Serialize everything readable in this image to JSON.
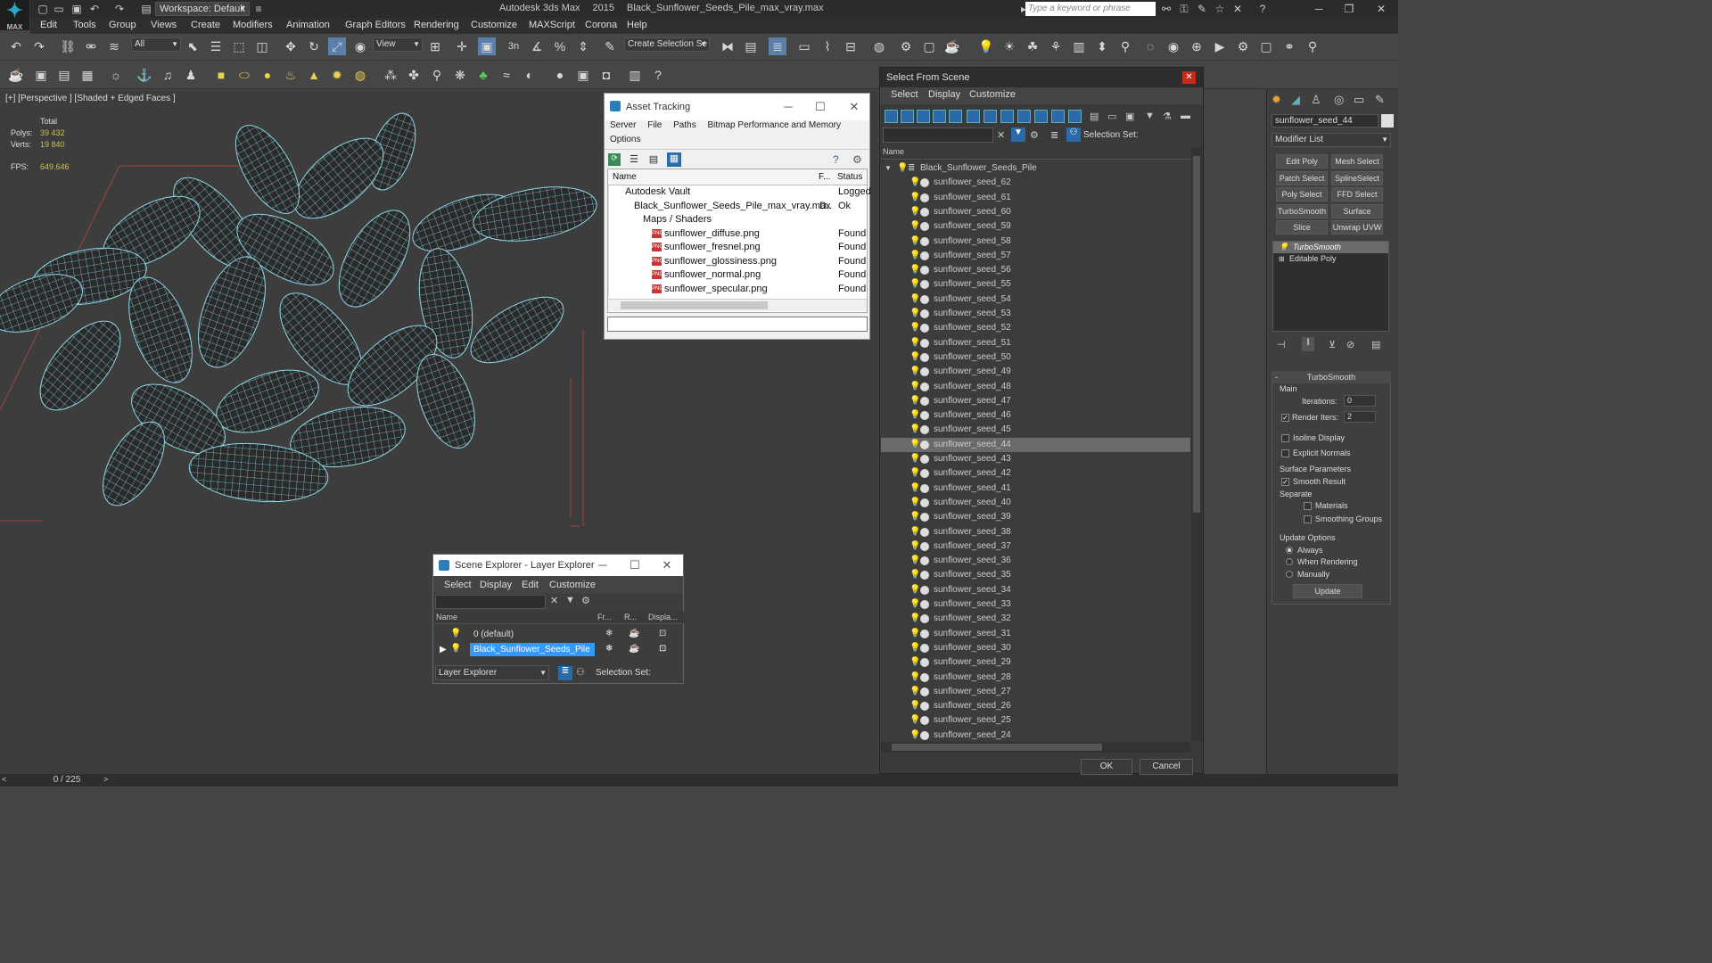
{
  "app": {
    "name": "Autodesk 3ds Max",
    "version": "2015",
    "file": "Black_Sunflower_Seeds_Pile_max_vray.max",
    "logo_text": "MAX",
    "workspace": "Workspace: Default",
    "search_placeholder": "Type a keyword or phrase"
  },
  "menus": [
    "Edit",
    "Tools",
    "Group",
    "Views",
    "Create",
    "Modifiers",
    "Animation",
    "Graph Editors",
    "Rendering",
    "Customize",
    "MAXScript",
    "Corona",
    "Help"
  ],
  "toolbar": {
    "selection_filter": "All",
    "ref_coord": "View",
    "create_selection_set": "Create Selection Se",
    "snap_label": "3n"
  },
  "viewport": {
    "label": "[+] [Perspective ] [Shaded + Edged Faces ]",
    "stats": {
      "total_label": "Total",
      "polys_label": "Polys:",
      "polys": "39 432",
      "verts_label": "Verts:",
      "verts": "19 840",
      "fps_label": "FPS:",
      "fps": "649.646"
    }
  },
  "timeline": {
    "frame": "0 / 225"
  },
  "asset_tracking": {
    "title": "Asset Tracking",
    "menus": [
      "Server",
      "File",
      "Paths",
      "Bitmap Performance and Memory",
      "Options"
    ],
    "columns": [
      "Name",
      "F...",
      "Status"
    ],
    "rows": [
      {
        "name": "Autodesk Vault",
        "f": "",
        "status": "Logged",
        "indent": 1
      },
      {
        "name": "Black_Sunflower_Seeds_Pile_max_vray.max",
        "f": "D..",
        "status": "Ok",
        "indent": 2
      },
      {
        "name": "Maps / Shaders",
        "f": "",
        "status": "",
        "indent": 3
      },
      {
        "name": "sunflower_diffuse.png",
        "f": "",
        "status": "Found",
        "indent": 4
      },
      {
        "name": "sunflower_fresnel.png",
        "f": "",
        "status": "Found",
        "indent": 4
      },
      {
        "name": "sunflower_glossiness.png",
        "f": "",
        "status": "Found",
        "indent": 4
      },
      {
        "name": "sunflower_normal.png",
        "f": "",
        "status": "Found",
        "indent": 4
      },
      {
        "name": "sunflower_specular.png",
        "f": "",
        "status": "Found",
        "indent": 4
      }
    ],
    "png_badge": "PNG"
  },
  "scene_explorer": {
    "title": "Scene Explorer - Layer Explorer",
    "menus": [
      "Select",
      "Display",
      "Edit",
      "Customize"
    ],
    "columns": [
      "Name",
      "Fr...",
      "R...",
      "Displa..."
    ],
    "rows": [
      {
        "name": "0 (default)",
        "selected": false
      },
      {
        "name": "Black_Sunflower_Seeds_Pile",
        "selected": true
      }
    ],
    "footer_dropdown": "Layer Explorer",
    "selection_set": "Selection Set:"
  },
  "select_from_scene": {
    "title": "Select From Scene",
    "menus": [
      "Select",
      "Display",
      "Customize"
    ],
    "selection_set": "Selection Set:",
    "column": "Name",
    "root": "Black_Sunflower_Seeds_Pile",
    "items": [
      "sunflower_seed_62",
      "sunflower_seed_61",
      "sunflower_seed_60",
      "sunflower_seed_59",
      "sunflower_seed_58",
      "sunflower_seed_57",
      "sunflower_seed_56",
      "sunflower_seed_55",
      "sunflower_seed_54",
      "sunflower_seed_53",
      "sunflower_seed_52",
      "sunflower_seed_51",
      "sunflower_seed_50",
      "sunflower_seed_49",
      "sunflower_seed_48",
      "sunflower_seed_47",
      "sunflower_seed_46",
      "sunflower_seed_45",
      "sunflower_seed_44",
      "sunflower_seed_43",
      "sunflower_seed_42",
      "sunflower_seed_41",
      "sunflower_seed_40",
      "sunflower_seed_39",
      "sunflower_seed_38",
      "sunflower_seed_37",
      "sunflower_seed_36",
      "sunflower_seed_35",
      "sunflower_seed_34",
      "sunflower_seed_33",
      "sunflower_seed_32",
      "sunflower_seed_31",
      "sunflower_seed_30",
      "sunflower_seed_29",
      "sunflower_seed_28",
      "sunflower_seed_27",
      "sunflower_seed_26",
      "sunflower_seed_25",
      "sunflower_seed_24"
    ],
    "selected_item": "sunflower_seed_44",
    "ok": "OK",
    "cancel": "Cancel"
  },
  "command_panel": {
    "object_name": "sunflower_seed_44",
    "modifier_list": "Modifier List",
    "buttons": [
      "Edit Poly",
      "Mesh Select",
      "Patch Select",
      "SplineSelect",
      "Poly Select",
      "FFD Select",
      "TurboSmooth",
      "Surface Select",
      "Slice",
      "Unwrap UVW"
    ],
    "stack": [
      "TurboSmooth",
      "Editable Poly"
    ],
    "rollout": {
      "title": "TurboSmooth",
      "main": "Main",
      "iterations_label": "Iterations:",
      "iterations": "0",
      "render_iters_label": "Render Iters:",
      "render_iters": "2",
      "isoline": "Isoline Display",
      "explicit": "Explicit Normals",
      "surface": "Surface Parameters",
      "smooth": "Smooth Result",
      "separate": "Separate",
      "materials": "Materials",
      "smoothing": "Smoothing Groups",
      "update_options": "Update Options",
      "always": "Always",
      "when_rendering": "When Rendering",
      "manually": "Manually",
      "update": "Update"
    }
  },
  "colors": {
    "accent": "#29a7c6",
    "wire": "#8fd8e8",
    "selection": "#3399ff"
  }
}
